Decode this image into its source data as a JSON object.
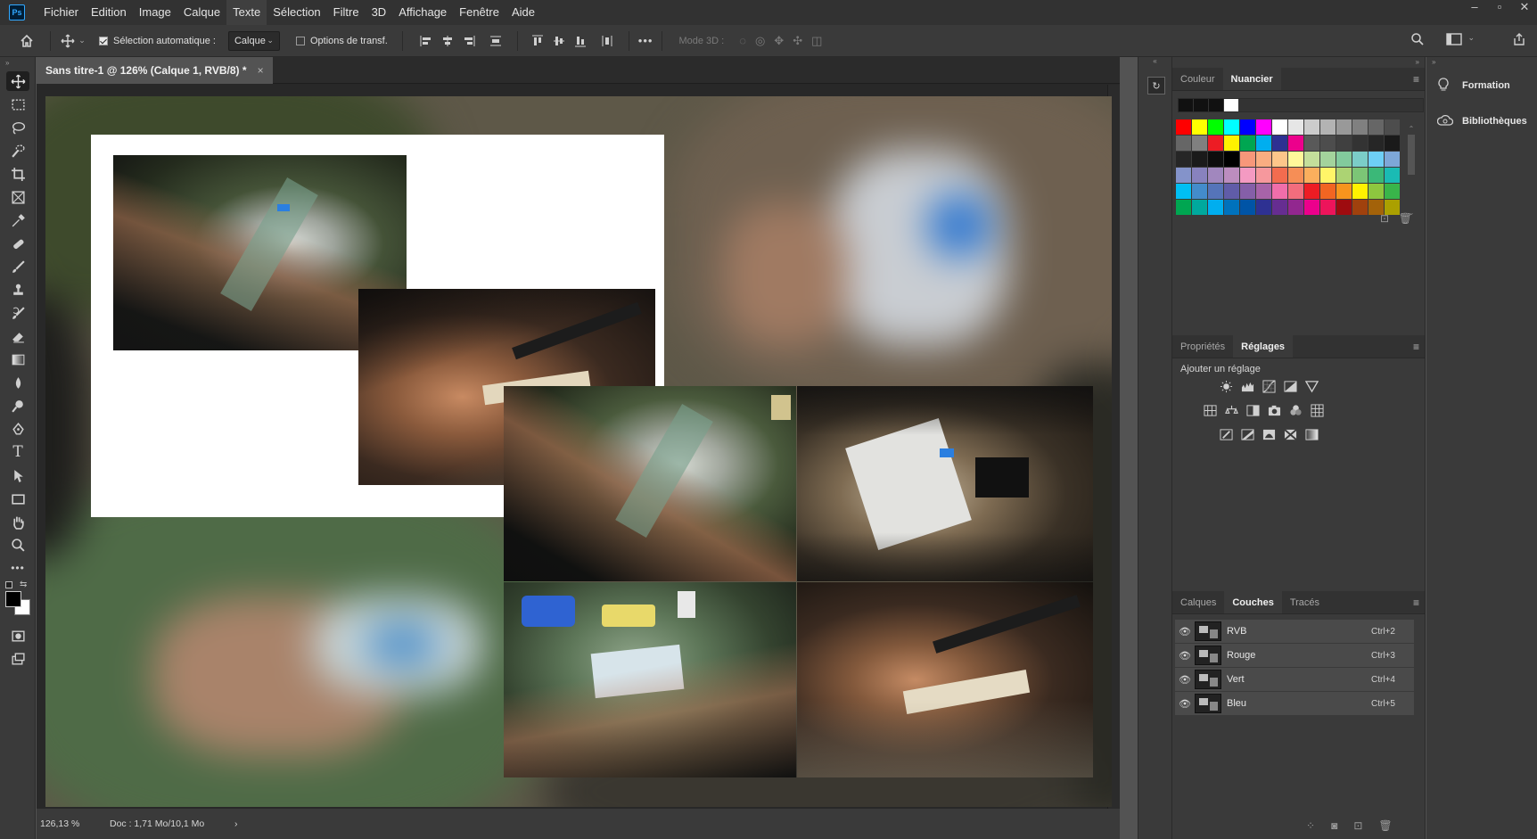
{
  "app": {
    "logo": "Ps"
  },
  "menubar": {
    "items": [
      "Fichier",
      "Edition",
      "Image",
      "Calque",
      "Texte",
      "Sélection",
      "Filtre",
      "3D",
      "Affichage",
      "Fenêtre",
      "Aide"
    ],
    "active_index": 4,
    "window_controls": [
      "minimize-icon",
      "maximize-icon",
      "close-icon"
    ]
  },
  "options": {
    "auto_select_label": "Sélection automatique :",
    "auto_select_checked": true,
    "target_value": "Calque",
    "transform_label": "Options de transf.",
    "transform_checked": false,
    "more": "•••",
    "mode3d_label": "Mode 3D :"
  },
  "tools": [
    {
      "name": "move-tool",
      "active": true
    },
    {
      "name": "marquee-tool"
    },
    {
      "name": "lasso-tool"
    },
    {
      "name": "quick-select-tool"
    },
    {
      "name": "crop-tool"
    },
    {
      "name": "frame-tool"
    },
    {
      "name": "eyedropper-tool"
    },
    {
      "name": "healing-brush-tool"
    },
    {
      "name": "brush-tool"
    },
    {
      "name": "clone-stamp-tool"
    },
    {
      "name": "history-brush-tool"
    },
    {
      "name": "eraser-tool"
    },
    {
      "name": "gradient-tool"
    },
    {
      "name": "blur-tool"
    },
    {
      "name": "dodge-tool"
    },
    {
      "name": "pen-tool"
    },
    {
      "name": "type-tool"
    },
    {
      "name": "path-select-tool"
    },
    {
      "name": "rectangle-tool"
    },
    {
      "name": "hand-tool"
    },
    {
      "name": "zoom-tool"
    },
    {
      "name": "more-tools"
    }
  ],
  "document": {
    "tab_title": "Sans titre-1 @ 126% (Calque 1, RVB/8) *",
    "close": "×"
  },
  "status": {
    "zoom": "126,13 %",
    "doc_info": "Doc : 1,71 Mo/10,1 Mo",
    "arrow": "›"
  },
  "colors": {
    "foreground": "#000000",
    "background": "#ffffff",
    "recent": [
      "#111111",
      "#111111",
      "#111111",
      "#ffffff"
    ],
    "swatches": [
      "#ff0000",
      "#ffff00",
      "#00ff00",
      "#00ffff",
      "#0000ff",
      "#ff00ff",
      "#ffffff",
      "#e6e6e6",
      "#cccccc",
      "#b3b3b3",
      "#999999",
      "#808080",
      "#666666",
      "#4d4d4d",
      "#666666",
      "#808080",
      "#ed1c24",
      "#fff200",
      "#00a651",
      "#00aeef",
      "#2e3192",
      "#ec008c",
      "#595959",
      "#4d4d4d",
      "#404040",
      "#333333",
      "#262626",
      "#1a1a1a",
      "#262626",
      "#1a1a1a",
      "#0d0d0d",
      "#000000",
      "#f7977a",
      "#f9ad81",
      "#fdc68a",
      "#fff79a",
      "#c4df9b",
      "#a3d39c",
      "#82ca9d",
      "#7bcdc8",
      "#6ecff6",
      "#7ea7d8",
      "#8493ca",
      "#8882be",
      "#a187be",
      "#bc8dbf",
      "#f49ac2",
      "#f6989d",
      "#f26c4f",
      "#f68e56",
      "#fbaf5d",
      "#fff568",
      "#acd373",
      "#7cc576",
      "#3bb878",
      "#1abbb4",
      "#00bff3",
      "#438ccb",
      "#5574b9",
      "#605ca8",
      "#855fa8",
      "#a763a8",
      "#f06eaa",
      "#f26d7d",
      "#ed1c24",
      "#f26522",
      "#f7941d",
      "#fff200",
      "#8dc73f",
      "#39b54a",
      "#00a651",
      "#00a99d",
      "#00aeef",
      "#0072bc",
      "#0054a6",
      "#2e3192",
      "#662d91",
      "#92278f",
      "#ec008c",
      "#ed145b",
      "#9e0b0f",
      "#a0410d",
      "#a36209",
      "#aba000"
    ]
  },
  "panels": {
    "color_tabs": [
      "Couleur",
      "Nuancier"
    ],
    "color_active": 1,
    "props_tabs": [
      "Propriétés",
      "Réglages"
    ],
    "props_active": 1,
    "adjustment_title": "Ajouter un réglage",
    "layers_tabs": [
      "Calques",
      "Couches",
      "Tracés"
    ],
    "layers_active": 1,
    "channels": [
      {
        "name": "RVB",
        "shortcut": "Ctrl+2"
      },
      {
        "name": "Rouge",
        "shortcut": "Ctrl+3"
      },
      {
        "name": "Vert",
        "shortcut": "Ctrl+4"
      },
      {
        "name": "Bleu",
        "shortcut": "Ctrl+5"
      }
    ],
    "menu_icon": "≡"
  },
  "far_panel": {
    "items": [
      {
        "label": "Formation",
        "icon": "lightbulb-icon"
      },
      {
        "label": "Bibliothèques",
        "icon": "cloud-library-icon"
      }
    ]
  }
}
